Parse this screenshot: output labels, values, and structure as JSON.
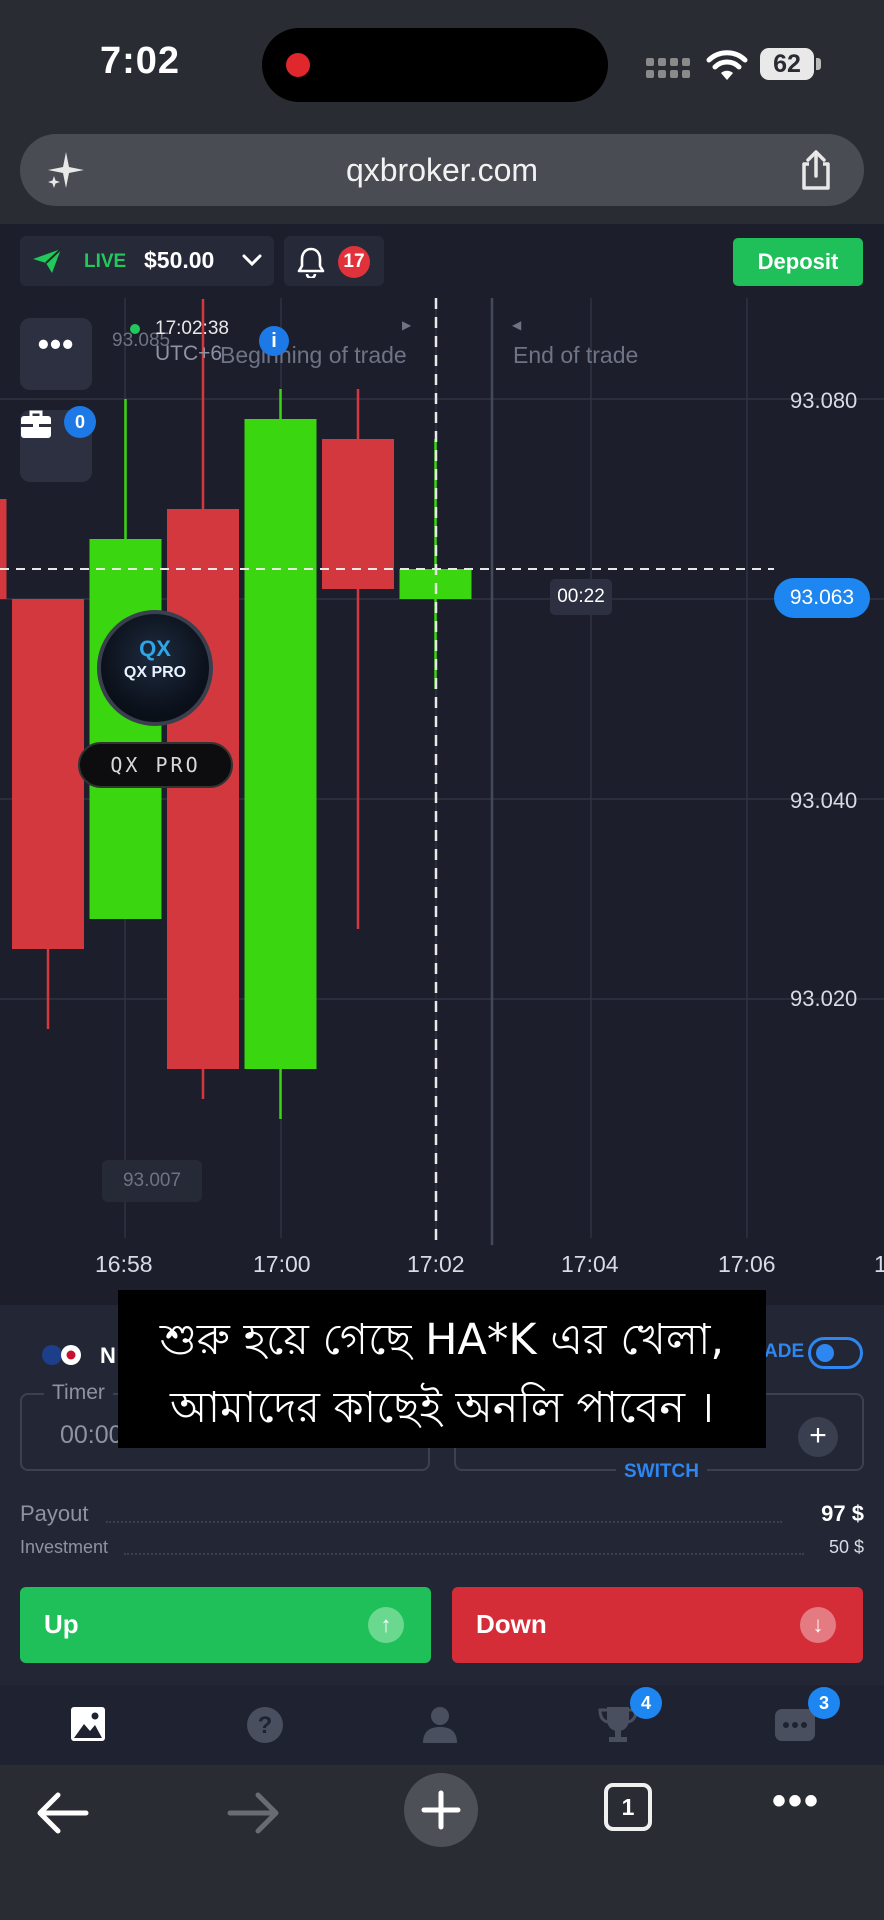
{
  "status_bar": {
    "time": "7:02",
    "battery": "62"
  },
  "browser": {
    "url": "qxbroker.com",
    "tab_count": "1"
  },
  "header": {
    "account_mode": "LIVE",
    "balance": "$50.00",
    "notification_count": "17",
    "deposit_label": "Deposit"
  },
  "chart": {
    "menu_glyph": "•••",
    "portfolio_count": "0",
    "cursor_time": "17:02:38",
    "timezone": "UTC+6",
    "info_glyph": "i",
    "beginning_label": "Beginning of trade",
    "end_label": "End of trade",
    "high_chip": "93.085",
    "low_chip": "93.007",
    "current_price": "93.063",
    "countdown": "00:22",
    "watermark_pill": "QX PRO",
    "watermark_mark": "QX",
    "watermark_text": "QX PRO"
  },
  "chart_data": {
    "type": "candlestick",
    "price_ticks": [
      "93.080",
      "93.040",
      "93.020"
    ],
    "time_ticks": [
      "16:58",
      "17:00",
      "17:02",
      "17:04",
      "17:06",
      "1"
    ],
    "candles": [
      {
        "open": 93.07,
        "close": 93.06,
        "high": 93.078,
        "low": 93.05,
        "color": "red"
      },
      {
        "open": 93.06,
        "close": 93.025,
        "high": 93.06,
        "low": 93.017,
        "color": "red"
      },
      {
        "open": 93.028,
        "close": 93.066,
        "high": 93.08,
        "low": 93.028,
        "color": "green"
      },
      {
        "open": 93.069,
        "close": 93.013,
        "high": 93.09,
        "low": 93.01,
        "color": "red"
      },
      {
        "open": 93.013,
        "close": 93.078,
        "high": 93.081,
        "low": 93.008,
        "color": "green"
      },
      {
        "open": 93.076,
        "close": 93.061,
        "high": 93.081,
        "low": 93.027,
        "color": "red"
      },
      {
        "open": 93.06,
        "close": 93.063,
        "high": 93.076,
        "low": 93.051,
        "color": "green"
      }
    ],
    "ylim": [
      93.0,
      93.092
    ],
    "grid": true
  },
  "trade": {
    "asset": "N",
    "trade_toggle_label": "ADE",
    "timer_label": "Timer",
    "timer_value": "00:00",
    "plus_glyph": "+",
    "switch_label": "SWITCH",
    "payout_label": "Payout",
    "payout_value": "97 $",
    "investment_label": "Investment",
    "investment_value": "50 $",
    "up_label": "Up",
    "down_label": "Down",
    "up_glyph": "↑",
    "down_glyph": "↓"
  },
  "subtitle": {
    "line1": "শুরু হয়ে গেছে HA*K এর খেলা,",
    "line2": "আমাদের কাছেই অনলি পাবেন ।"
  },
  "app_nav": {
    "trophy_badge": "4",
    "chat_badge": "3"
  },
  "colors": {
    "up": "#1fbf5a",
    "down": "#d42d38",
    "accent": "#1d86f0",
    "candle_green": "#3ad60f",
    "candle_red": "#d2383e"
  }
}
